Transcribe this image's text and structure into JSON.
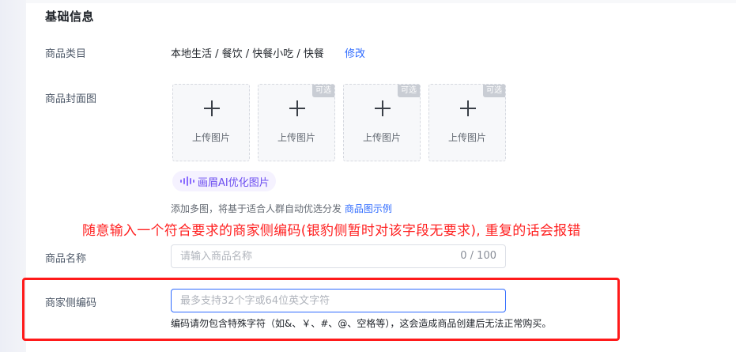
{
  "section": {
    "title": "基础信息"
  },
  "category": {
    "label": "商品类目",
    "value": "本地生活 / 餐饮 / 快餐小吃 / 快餐",
    "modify_link": "修改"
  },
  "cover": {
    "label": "商品封面图",
    "upload_text": "上传图片",
    "optional_tag": "可选",
    "ai_button_label": "画眉AI优化图片",
    "hint": "添加多图，将基于适合人群自动优选分发",
    "example_link": "商品图示例"
  },
  "annotation": "随意输入一个符合要求的商家侧编码(银豹侧暂时对该字段无要求), 重复的话会报错",
  "product_name": {
    "label": "商品名称",
    "placeholder": "请输入商品名称",
    "value": "",
    "counter": "0 / 100"
  },
  "merchant_code": {
    "label": "商家侧编码",
    "placeholder": "最多支持32个字或64位英文字符",
    "value": "",
    "helper": "编码请勿包含特殊字符（如&、￥、#、@、空格等），这会造成商品创建后无法正常购买。"
  },
  "colors": {
    "accent": "#2f6bff",
    "annotation": "#ff2020",
    "ai_purple": "#6b4cf0"
  },
  "icons": {
    "upload": "plus-icon",
    "ai": "sound-wave-icon"
  }
}
